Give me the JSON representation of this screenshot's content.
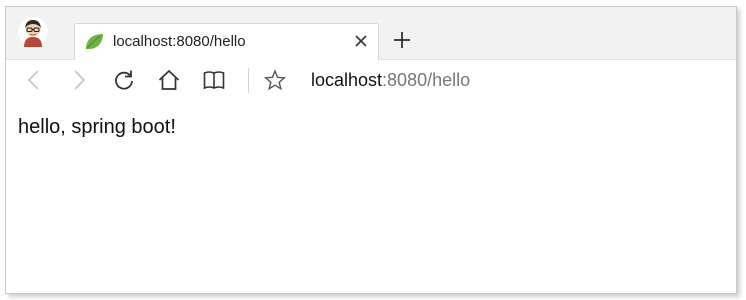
{
  "browser": {
    "tab": {
      "title": "localhost:8080/hello",
      "favicon": "spring-leaf-icon"
    },
    "toolbar": {
      "back_icon": "back-arrow-icon",
      "forward_icon": "forward-arrow-icon",
      "refresh_icon": "refresh-icon",
      "home_icon": "home-icon",
      "reading_icon": "book-icon",
      "favorite_icon": "star-icon"
    },
    "address": {
      "host": "localhost",
      "rest": ":8080/hello"
    }
  },
  "page": {
    "body_text": "hello, spring boot!"
  },
  "colors": {
    "tabstrip_bg": "#f2f2f2",
    "spring_green": "#6db33f",
    "icon_dark": "#333333",
    "icon_disabled": "#c8c8c8"
  }
}
